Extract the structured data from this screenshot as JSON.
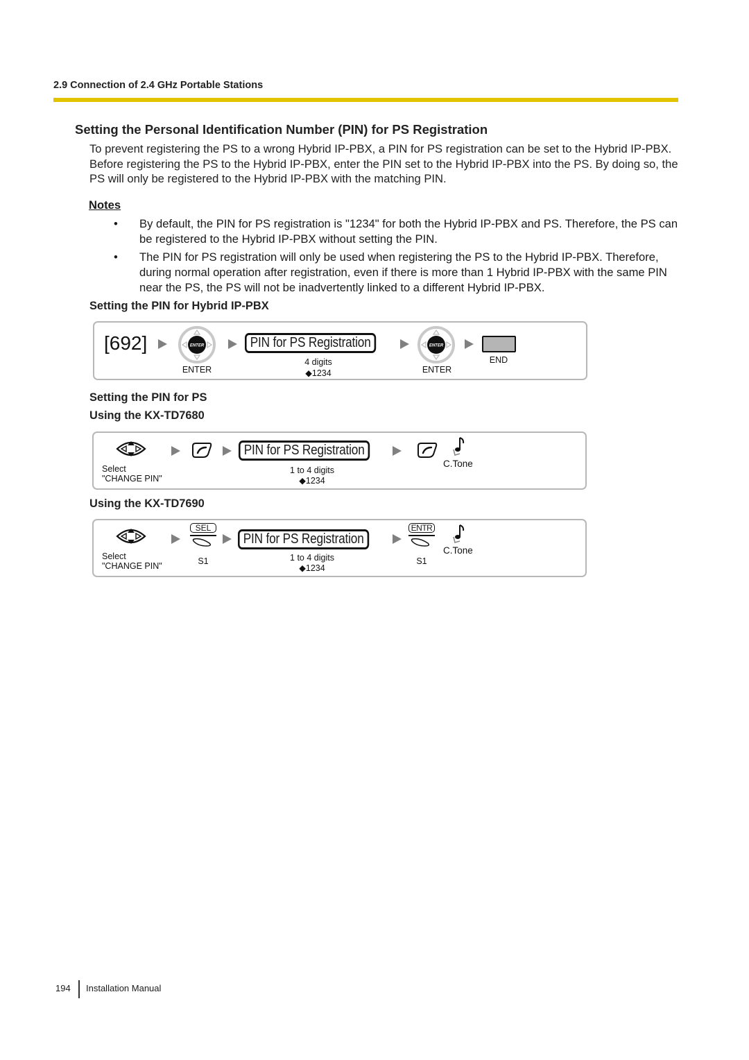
{
  "header": {
    "section": "2.9 Connection of 2.4 GHz Portable Stations",
    "accent_color": "#e1c300"
  },
  "title": "Setting the Personal Identification Number (PIN) for PS Registration",
  "intro": "To prevent registering the PS to a wrong Hybrid IP-PBX, a PIN for PS registration can be set to the Hybrid IP-PBX. Before registering the PS to the Hybrid IP-PBX, enter the PIN set to the Hybrid IP-PBX into the PS. By doing so, the PS will only be registered to the Hybrid IP-PBX with the matching PIN.",
  "notes": {
    "title": "Notes",
    "bullet_glyph": "•",
    "items": [
      "By default, the PIN for PS registration is \"1234\" for both the Hybrid IP-PBX and PS. Therefore, the PS can be registered to the Hybrid IP-PBX without setting the PIN.",
      "The PIN for PS registration will only be used when registering the PS to the Hybrid IP-PBX. Therefore, during normal operation after registration, even if there is more than 1 Hybrid IP-PBX with the same PIN near the PS, the PS will not be inadvertently linked to a different Hybrid IP-PBX."
    ]
  },
  "pbx_section": {
    "heading": "Setting the PIN for Hybrid IP-PBX",
    "program_code": "[692]",
    "enter_key_text": "ENTER",
    "enter_label_1": "ENTER",
    "field_label": "PIN for PS Registration",
    "field_range": "4 digits",
    "field_default": "◆1234",
    "enter_label_2": "ENTER",
    "end_label": "END"
  },
  "ps_section": {
    "heading": "Setting the PIN for PS",
    "td7680": {
      "heading": "Using the KX-TD7680",
      "select_line1": "Select",
      "select_line2": "\"CHANGE PIN\"",
      "field_label": "PIN for PS Registration",
      "field_range": "1 to 4 digits",
      "field_default": "◆1234",
      "tone_label": "C.Tone"
    },
    "td7690": {
      "heading": "Using the KX-TD7690",
      "select_line1": "Select",
      "select_line2": "\"CHANGE PIN\"",
      "softkey1_text": "SEL",
      "softkey1_label": "S1",
      "field_label": "PIN for PS Registration",
      "field_range": "1 to 4 digits",
      "field_default": "◆1234",
      "softkey2_text": "ENTR",
      "softkey2_label": "S1",
      "tone_label": "C.Tone"
    }
  },
  "footer": {
    "page_number": "194",
    "doc_title": "Installation Manual"
  }
}
